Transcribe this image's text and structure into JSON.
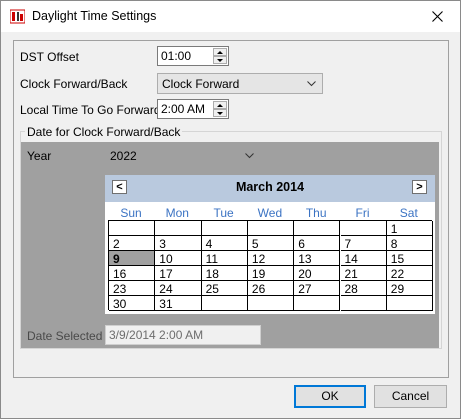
{
  "window": {
    "title": "Daylight Time Settings"
  },
  "form": {
    "dst_offset_label": "DST Offset",
    "dst_offset_value": "01:00",
    "clock_label": "Clock Forward/Back",
    "clock_value": "Clock Forward",
    "local_time_label": "Local Time To Go Forward",
    "local_time_value": "2:00 AM"
  },
  "group": {
    "title": "Date for Clock Forward/Back",
    "year_label": "Year",
    "year_value": "2022",
    "date_selected_label": "Date Selected",
    "date_selected_value": "3/9/2014 2:00 AM"
  },
  "calendar": {
    "title": "March 2014",
    "prev": "<",
    "next": ">",
    "days_of_week": [
      "Sun",
      "Mon",
      "Tue",
      "Wed",
      "Thu",
      "Fri",
      "Sat"
    ],
    "weeks": [
      [
        "",
        "",
        "",
        "",
        "",
        "",
        "1"
      ],
      [
        "2",
        "3",
        "4",
        "5",
        "6",
        "7",
        "8"
      ],
      [
        "9",
        "10",
        "11",
        "12",
        "13",
        "14",
        "15"
      ],
      [
        "16",
        "17",
        "18",
        "19",
        "20",
        "21",
        "22"
      ],
      [
        "23",
        "24",
        "25",
        "26",
        "27",
        "28",
        "29"
      ],
      [
        "30",
        "31",
        "",
        "",
        "",
        "",
        ""
      ]
    ],
    "selected_day": "9"
  },
  "buttons": {
    "ok": "OK",
    "cancel": "Cancel"
  },
  "colors": {
    "calendar_header": "#b9c9de",
    "weekday_text": "#3b73c3",
    "panel_gray": "#a0a0a0",
    "default_button_border": "#0078d7"
  }
}
